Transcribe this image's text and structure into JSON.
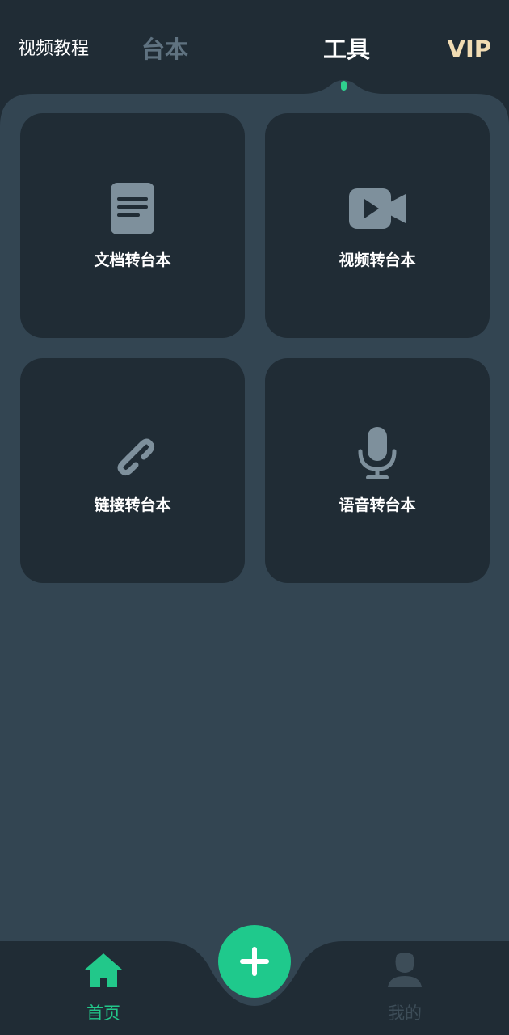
{
  "header": {
    "tutorial_link": "视频教程",
    "tabs": [
      {
        "label": "台本",
        "active": false
      },
      {
        "label": "工具",
        "active": true
      }
    ],
    "vip_label": "VIP"
  },
  "tools": [
    {
      "label": "文档转台本",
      "icon": "document-icon"
    },
    {
      "label": "视频转台本",
      "icon": "video-camera-icon"
    },
    {
      "label": "链接转台本",
      "icon": "link-icon"
    },
    {
      "label": "语音转台本",
      "icon": "microphone-icon"
    }
  ],
  "bottom_nav": {
    "home_label": "首页",
    "mine_label": "我的",
    "add_icon": "plus-icon"
  },
  "colors": {
    "background_dark": "#202c35",
    "panel": "#334552",
    "accent_green": "#1fc98c",
    "icon_gray": "#7e909c",
    "vip_gold": "#f1dcb3"
  }
}
